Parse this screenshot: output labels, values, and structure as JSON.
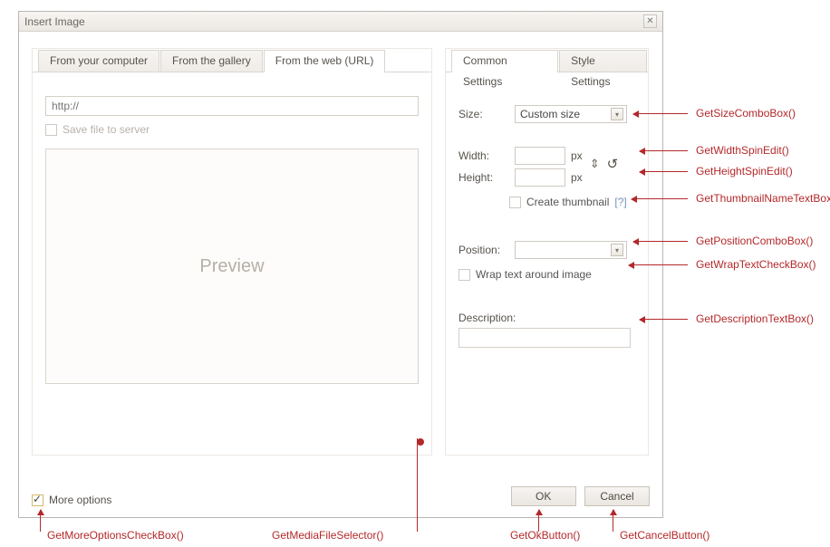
{
  "dialog": {
    "title": "Insert Image",
    "close": "✕"
  },
  "leftTabs": {
    "t0": "From your computer",
    "t1": "From the gallery",
    "t2": "From the web (URL)"
  },
  "web": {
    "url_placeholder": "http://",
    "save_label": "Save file to server",
    "preview": "Preview"
  },
  "rightTabs": {
    "t0": "Common Settings",
    "t1": "Style Settings"
  },
  "settings": {
    "size_label": "Size:",
    "size_value": "Custom size",
    "width_label": "Width:",
    "height_label": "Height:",
    "px": "px",
    "thumb_label": "Create thumbnail",
    "thumb_help": "[?]",
    "position_label": "Position:",
    "wrap_label": "Wrap text around image",
    "desc_label": "Description:"
  },
  "footer": {
    "more": "More options",
    "ok": "OK",
    "cancel": "Cancel"
  },
  "callouts": {
    "size": "GetSizeComboBox()",
    "width": "GetWidthSpinEdit()",
    "height": "GetHeightSpinEdit()",
    "thumb": "GetThumbnailNameTextBox()",
    "pos": "GetPositionComboBox()",
    "wrap": "GetWrapTextCheckBox()",
    "desc": "GetDescriptionTextBox()",
    "more": "GetMoreOptionsCheckBox()",
    "media": "GetMediaFileSelector()",
    "ok": "GetOkButton()",
    "cancel": "GetCancelButton()"
  }
}
